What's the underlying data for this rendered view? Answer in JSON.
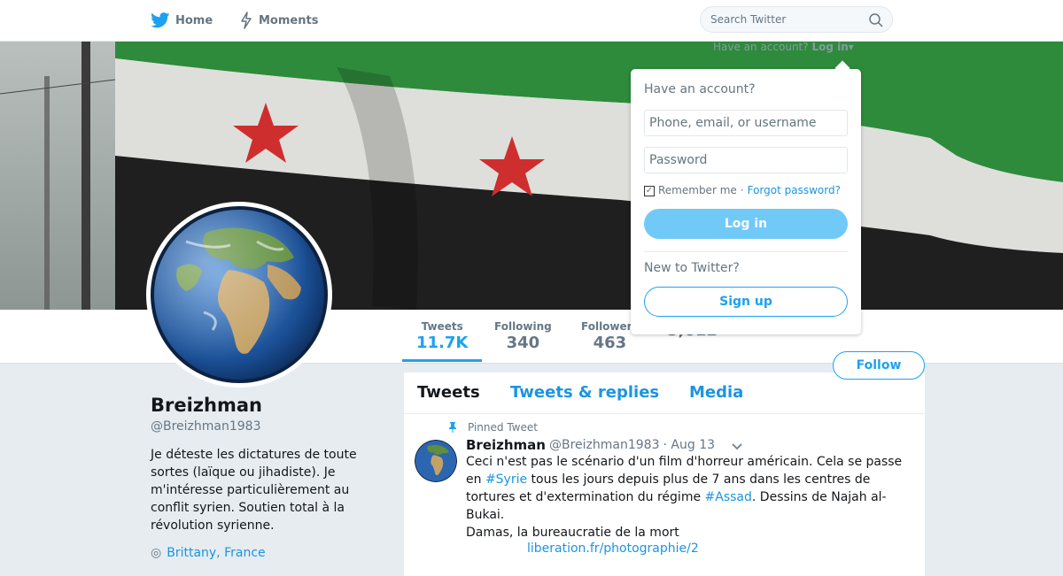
{
  "nav": {
    "home_label": "Home",
    "moments_label": "Moments",
    "search_placeholder": "Search Twitter"
  },
  "header": {
    "have_account_text": "Have an account?",
    "login_link": "Log in"
  },
  "profile": {
    "name": "Breizhman",
    "handle": "@Breizhman1983",
    "bio": "Je déteste les dictatures de toute sortes (laïque ou jihadiste). Je m'intéresse particulièrement au conflit syrien. Soutien total à la révolution syrienne.",
    "location": "Brittany, France",
    "follow_label": "Follow"
  },
  "stats": [
    {
      "label": "Tweets",
      "value": "11.7K"
    },
    {
      "label": "Following",
      "value": "340"
    },
    {
      "label": "Followers",
      "value": "463"
    },
    {
      "label": "",
      "value": "5,612"
    }
  ],
  "timeline": {
    "tabs": [
      "Tweets",
      "Tweets & replies",
      "Media"
    ],
    "pinned_label": "Pinned Tweet",
    "tweet": {
      "name": "Breizhman",
      "handle": "@Breizhman1983",
      "date": "· Aug 13",
      "text_1": "Ceci n'est pas le scénario d'un film d'horreur américain. Cela se passe en ",
      "hashtag_1": "#Syrie",
      "text_2": " tous les jours depuis plus de 7 ans dans les centres de tortures et d'extermination du régime ",
      "hashtag_2": "#Assad",
      "text_3": ". Dessins de Najah al-Bukai.",
      "text_4": "Damas, la bureaucratie de la mort",
      "link": "liberation.fr/photographie/2"
    }
  },
  "login_dropdown": {
    "title": "Have an account?",
    "username_placeholder": "Phone, email, or username",
    "password_placeholder": "Password",
    "remember_label": "Remember me",
    "separator": "·",
    "forgot_label": "Forgot password?",
    "login_button": "Log in",
    "new_label": "New to Twitter?",
    "signup_button": "Sign up"
  },
  "colors": {
    "accent": "#1da1f2",
    "flag_green": "#2e8b3c",
    "flag_white": "#e4e4e0",
    "flag_black": "#1c1c1c",
    "flag_star_red": "#d32f2f"
  }
}
